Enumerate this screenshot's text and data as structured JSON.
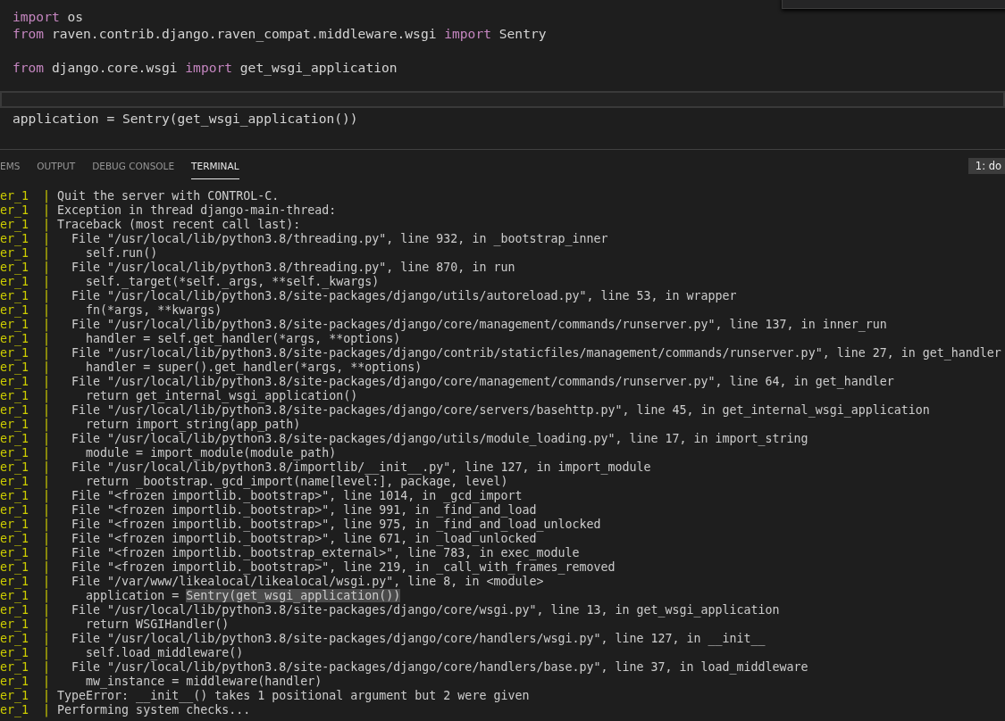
{
  "editor": {
    "lines": [
      {
        "current": false,
        "segments": [
          {
            "kind": "keyword",
            "text": "import"
          },
          {
            "kind": "plain",
            "text": " os"
          }
        ]
      },
      {
        "current": false,
        "segments": [
          {
            "kind": "keyword",
            "text": "from"
          },
          {
            "kind": "plain",
            "text": " raven.contrib.django.raven_compat.middleware.wsgi "
          },
          {
            "kind": "keyword",
            "text": "import"
          },
          {
            "kind": "plain",
            "text": " Sentry"
          }
        ]
      },
      {
        "current": false
      },
      {
        "current": false,
        "segments": [
          {
            "kind": "keyword",
            "text": "from"
          },
          {
            "kind": "plain",
            "text": " django.core.wsgi "
          },
          {
            "kind": "keyword",
            "text": "import"
          },
          {
            "kind": "plain",
            "text": " get_wsgi_application"
          }
        ]
      },
      {
        "current": false
      },
      {
        "current": true
      },
      {
        "current": false,
        "segments": [
          {
            "kind": "plain",
            "text": "application = Sentry(get_wsgi_application())"
          }
        ]
      }
    ]
  },
  "panel": {
    "tabs": [
      {
        "label": "EMS",
        "selected": false
      },
      {
        "label": "OUTPUT",
        "selected": false
      },
      {
        "label": "DEBUG CONSOLE",
        "selected": false
      },
      {
        "label": "TERMINAL",
        "selected": true
      }
    ],
    "terminal_selector": "1: do",
    "terminal": [
      {
        "prefix": "er_1  |",
        "text": "Quit the server with CONTROL-C."
      },
      {
        "prefix": "er_1  |",
        "text": "Exception in thread django-main-thread:"
      },
      {
        "prefix": "er_1  |",
        "text": "Traceback (most recent call last):"
      },
      {
        "prefix": "er_1  |",
        "text": "  File \"/usr/local/lib/python3.8/threading.py\", line 932, in _bootstrap_inner"
      },
      {
        "prefix": "er_1  |",
        "text": "    self.run()"
      },
      {
        "prefix": "er_1  |",
        "text": "  File \"/usr/local/lib/python3.8/threading.py\", line 870, in run"
      },
      {
        "prefix": "er_1  |",
        "text": "    self._target(*self._args, **self._kwargs)"
      },
      {
        "prefix": "er_1  |",
        "text": "  File \"/usr/local/lib/python3.8/site-packages/django/utils/autoreload.py\", line 53, in wrapper"
      },
      {
        "prefix": "er_1  |",
        "text": "    fn(*args, **kwargs)"
      },
      {
        "prefix": "er_1  |",
        "text": "  File \"/usr/local/lib/python3.8/site-packages/django/core/management/commands/runserver.py\", line 137, in inner_run"
      },
      {
        "prefix": "er_1  |",
        "text": "    handler = self.get_handler(*args, **options)"
      },
      {
        "prefix": "er_1  |",
        "text": "  File \"/usr/local/lib/python3.8/site-packages/django/contrib/staticfiles/management/commands/runserver.py\", line 27, in get_handler"
      },
      {
        "prefix": "er_1  |",
        "text": "    handler = super().get_handler(*args, **options)"
      },
      {
        "prefix": "er_1  |",
        "text": "  File \"/usr/local/lib/python3.8/site-packages/django/core/management/commands/runserver.py\", line 64, in get_handler"
      },
      {
        "prefix": "er_1  |",
        "text": "    return get_internal_wsgi_application()"
      },
      {
        "prefix": "er_1  |",
        "text": "  File \"/usr/local/lib/python3.8/site-packages/django/core/servers/basehttp.py\", line 45, in get_internal_wsgi_application"
      },
      {
        "prefix": "er_1  |",
        "text": "    return import_string(app_path)"
      },
      {
        "prefix": "er_1  |",
        "text": "  File \"/usr/local/lib/python3.8/site-packages/django/utils/module_loading.py\", line 17, in import_string"
      },
      {
        "prefix": "er_1  |",
        "text": "    module = import_module(module_path)"
      },
      {
        "prefix": "er_1  |",
        "text": "  File \"/usr/local/lib/python3.8/importlib/__init__.py\", line 127, in import_module"
      },
      {
        "prefix": "er_1  |",
        "text": "    return _bootstrap._gcd_import(name[level:], package, level)"
      },
      {
        "prefix": "er_1  |",
        "text": "  File \"<frozen importlib._bootstrap>\", line 1014, in _gcd_import"
      },
      {
        "prefix": "er_1  |",
        "text": "  File \"<frozen importlib._bootstrap>\", line 991, in _find_and_load"
      },
      {
        "prefix": "er_1  |",
        "text": "  File \"<frozen importlib._bootstrap>\", line 975, in _find_and_load_unlocked"
      },
      {
        "prefix": "er_1  |",
        "text": "  File \"<frozen importlib._bootstrap>\", line 671, in _load_unlocked"
      },
      {
        "prefix": "er_1  |",
        "text": "  File \"<frozen importlib._bootstrap_external>\", line 783, in exec_module"
      },
      {
        "prefix": "er_1  |",
        "text": "  File \"<frozen importlib._bootstrap>\", line 219, in _call_with_frames_removed"
      },
      {
        "prefix": "er_1  |",
        "text": "  File \"/var/www/likealocal/likealocal/wsgi.py\", line 8, in <module>"
      },
      {
        "prefix": "er_1  |",
        "text": "    application = ",
        "selection": "Sentry(get_wsgi_application())"
      },
      {
        "prefix": "er_1  |",
        "text": "  File \"/usr/local/lib/python3.8/site-packages/django/core/wsgi.py\", line 13, in get_wsgi_application"
      },
      {
        "prefix": "er_1  |",
        "text": "    return WSGIHandler()"
      },
      {
        "prefix": "er_1  |",
        "text": "  File \"/usr/local/lib/python3.8/site-packages/django/core/handlers/wsgi.py\", line 127, in __init__"
      },
      {
        "prefix": "er_1  |",
        "text": "    self.load_middleware()"
      },
      {
        "prefix": "er_1  |",
        "text": "  File \"/usr/local/lib/python3.8/site-packages/django/core/handlers/base.py\", line 37, in load_middleware"
      },
      {
        "prefix": "er_1  |",
        "text": "    mw_instance = middleware(handler)"
      },
      {
        "prefix": "er_1  |",
        "text": "TypeError: __init__() takes 1 positional argument but 2 were given"
      },
      {
        "prefix": "er_1  |",
        "text": "Performing system checks..."
      }
    ]
  }
}
